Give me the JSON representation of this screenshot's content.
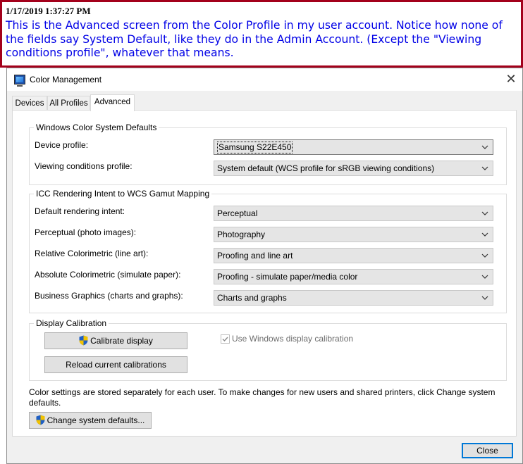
{
  "annotation": {
    "timestamp": "1/17/2019 1:37:27 PM",
    "text": "This is the Advanced screen from the Color Profile in my user account. Notice how none of the fields say System Default, like they do in the Admin Account. (Except the \"Viewing conditions profile\", whatever that means."
  },
  "window": {
    "title": "Color Management",
    "close_glyph": "✕"
  },
  "tabs": [
    {
      "label": "Devices"
    },
    {
      "label": "All Profiles"
    },
    {
      "label": "Advanced",
      "active": true
    }
  ],
  "wcs_defaults": {
    "heading": "Windows Color System Defaults",
    "device_profile": {
      "label": "Device profile:",
      "value": "Samsung S22E450"
    },
    "viewing_conditions": {
      "label": "Viewing conditions profile:",
      "value": "System default (WCS profile for sRGB viewing conditions)"
    }
  },
  "icc_mapping": {
    "heading": "ICC Rendering Intent to WCS Gamut Mapping",
    "rows": [
      {
        "label": "Default rendering intent:",
        "value": "Perceptual"
      },
      {
        "label": "Perceptual (photo images):",
        "value": "Photography"
      },
      {
        "label": "Relative Colorimetric (line art):",
        "value": "Proofing and line art"
      },
      {
        "label": "Absolute Colorimetric (simulate paper):",
        "value": "Proofing - simulate paper/media color"
      },
      {
        "label": "Business Graphics (charts and graphs):",
        "value": "Charts and graphs"
      }
    ]
  },
  "display_calibration": {
    "heading": "Display Calibration",
    "calibrate_button": "Calibrate display",
    "reload_button": "Reload current calibrations",
    "use_windows_calibration": {
      "label": "Use Windows display calibration",
      "checked": true,
      "disabled": true
    }
  },
  "footer": {
    "info": "Color settings are stored separately for each user. To make changes for new users and shared printers, click Change system defaults.",
    "change_defaults_button": "Change system defaults...",
    "close_button": "Close"
  },
  "icons": {
    "app": "color-management-monitor-icon",
    "uac": "uac-shield-icon",
    "dropdown": "chevron-down-icon"
  },
  "colors": {
    "annotation_border": "#a3001b",
    "annotation_text": "#0000e6",
    "window_bg": "#f0f0f0",
    "accent": "#0078d7"
  }
}
